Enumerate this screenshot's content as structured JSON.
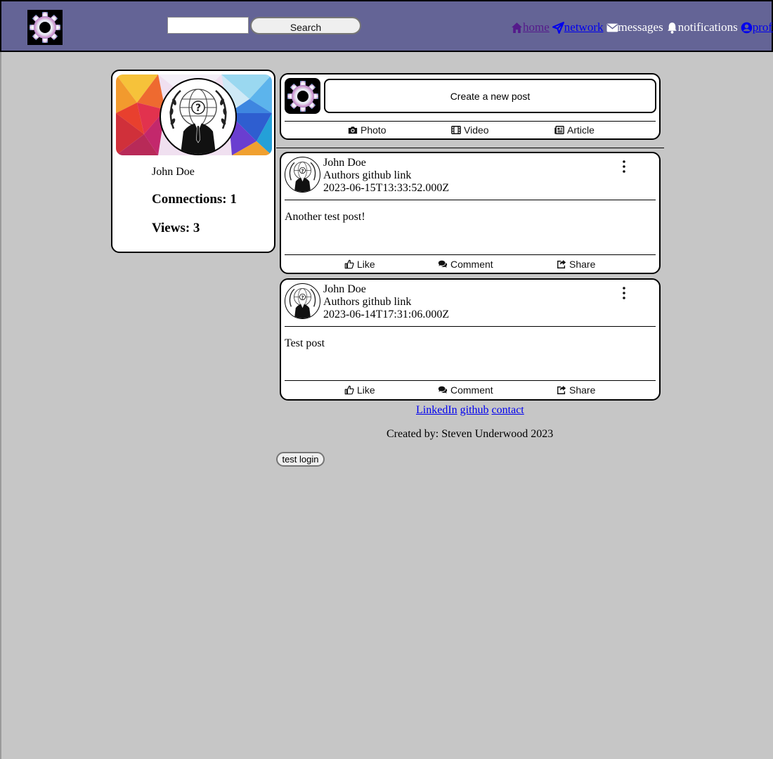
{
  "header": {
    "search": {
      "placeholder": "",
      "button_label": "Search"
    },
    "nav": [
      {
        "label": "home",
        "icon": "home-icon"
      },
      {
        "label": "network",
        "icon": "send-icon"
      },
      {
        "label": "messages",
        "icon": "envelope-icon"
      },
      {
        "label": "notifications",
        "icon": "bell-icon"
      },
      {
        "label": "profile",
        "icon": "user-circle-icon"
      }
    ]
  },
  "profile": {
    "name": "John Doe",
    "connections": "Connections: 1",
    "views": "Views: 3"
  },
  "composer": {
    "button_label": "Create a new post",
    "actions": [
      {
        "label": "Photo",
        "icon": "camera-icon"
      },
      {
        "label": "Video",
        "icon": "film-icon"
      },
      {
        "label": "Article",
        "icon": "newspaper-icon"
      }
    ]
  },
  "posts": [
    {
      "author": "John Doe",
      "link": "Authors github link",
      "timestamp": "2023-06-15T13:33:52.000Z",
      "body": "Another test post!"
    },
    {
      "author": "John Doe",
      "link": "Authors github link",
      "timestamp": "2023-06-14T17:31:06.000Z",
      "body": "Test post"
    }
  ],
  "post_actions": [
    {
      "label": "Like",
      "icon": "thumbs-up-icon"
    },
    {
      "label": "Comment",
      "icon": "comments-icon"
    },
    {
      "label": "Share",
      "icon": "share-icon"
    }
  ],
  "footer": {
    "links": [
      "LinkedIn",
      "github",
      "contact"
    ],
    "credit": "Created by: Steven Underwood 2023"
  },
  "test_login_label": "test login",
  "colors": {
    "header_bg": "#646496",
    "page_bg": "#c6c6c6",
    "link": "#0000ee",
    "visited_link": "#551a8b"
  }
}
